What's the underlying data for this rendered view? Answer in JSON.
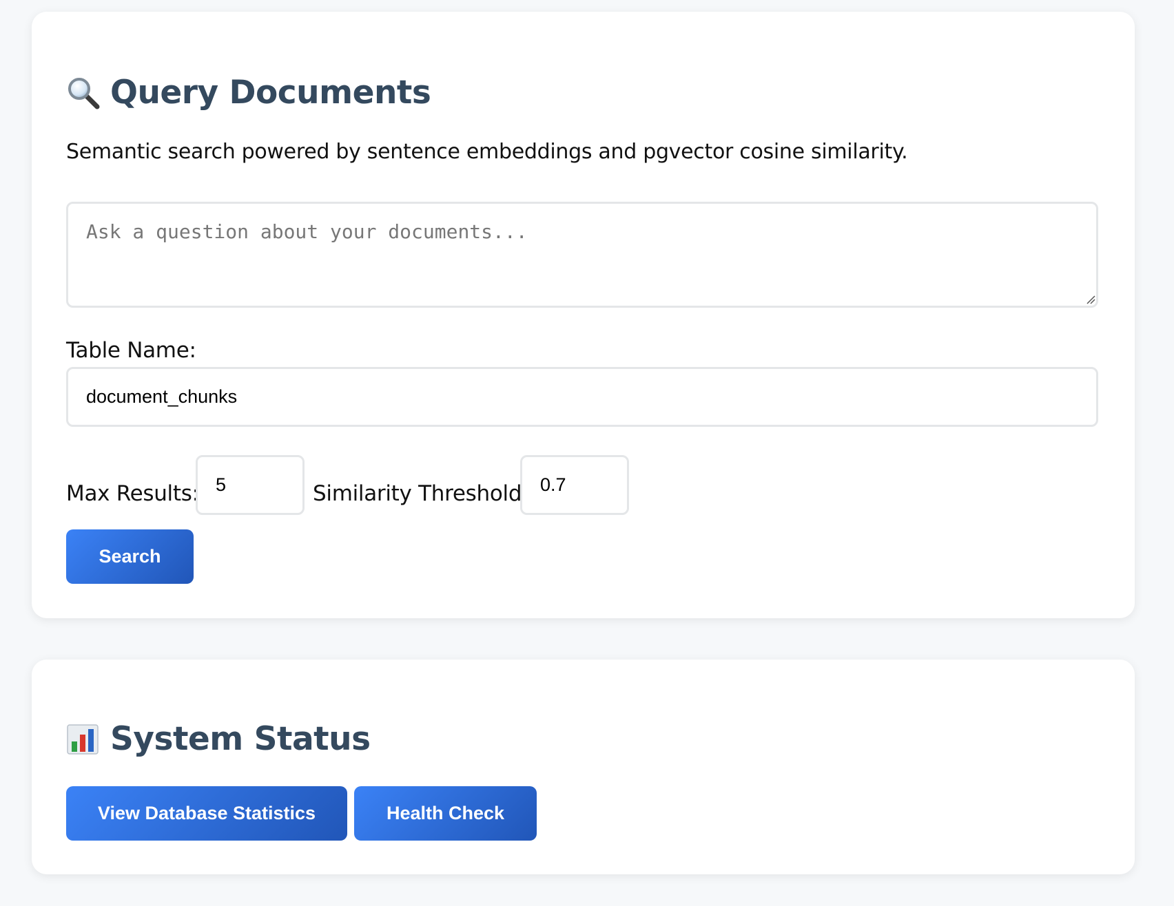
{
  "query_section": {
    "title": "Query Documents",
    "icon": "magnifying-glass-icon",
    "subtitle": "Semantic search powered by sentence embeddings and pgvector cosine similarity.",
    "query": {
      "placeholder": "Ask a question about your documents...",
      "value": ""
    },
    "table_name": {
      "label": "Table Name:",
      "value": "document_chunks"
    },
    "max_results": {
      "label": "Max Results:",
      "value": "5"
    },
    "similarity_threshold": {
      "label": "Similarity Threshold:",
      "value": "0.7"
    },
    "search_label": "Search"
  },
  "status_section": {
    "title": "System Status",
    "icon": "bar-chart-icon",
    "db_stats_label": "View Database Statistics",
    "health_check_label": "Health Check"
  },
  "colors": {
    "page_background": "#f6f8fa",
    "card_background": "#ffffff",
    "heading": "#34495e",
    "button_gradient_start": "#3b82f6",
    "button_gradient_end": "#2156b8",
    "input_border": "#e4e6e8"
  }
}
